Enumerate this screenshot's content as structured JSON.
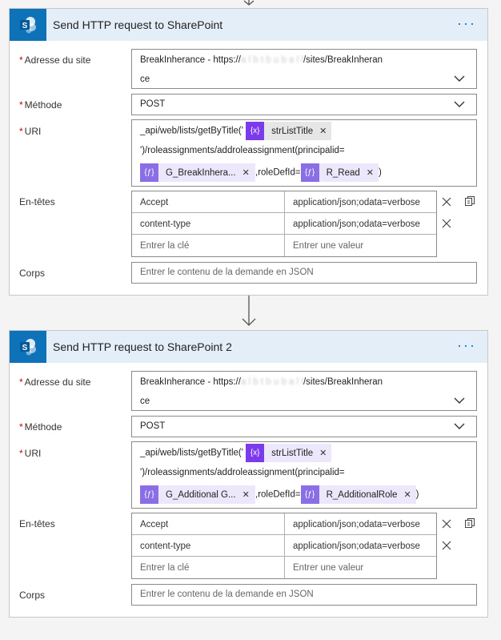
{
  "actions": [
    {
      "title": "Send HTTP request to SharePoint",
      "fields": {
        "site_label": "Adresse du site",
        "site_line1": "BreakInherance - https://",
        "site_blur": "a l  b  t   b  u  b  a  l  l",
        "site_line1_end": "/sites/BreakInheran",
        "site_line2": "ce",
        "method_label": "Méthode",
        "method_value": "POST",
        "uri_label": "URI",
        "uri_line1": "_api/web/lists/getByTitle('",
        "uri_token1": "strListTitle",
        "uri_line2": "')/roleassignments/addroleassignment(principalid=",
        "uri_token2": "G_BreakInhera...",
        "uri_mid": ",roleDefId=",
        "uri_token3": "R_Read",
        "uri_end": ")",
        "headers_label": "En-têtes",
        "headers": [
          {
            "key": "Accept",
            "value": "application/json;odata=verbose"
          },
          {
            "key": "content-type",
            "value": "application/json;odata=verbose"
          }
        ],
        "header_key_placeholder": "Entrer la clé",
        "header_value_placeholder": "Entrer une valeur",
        "body_label": "Corps",
        "body_placeholder": "Entrer le contenu de la demande en JSON"
      }
    },
    {
      "title": "Send HTTP request to SharePoint 2",
      "fields": {
        "site_label": "Adresse du site",
        "site_line1": "BreakInherance - https://",
        "site_blur": "a l  b  t   b  u  b  a  l  l",
        "site_line1_end": "/sites/BreakInheran",
        "site_line2": "ce",
        "method_label": "Méthode",
        "method_value": "POST",
        "uri_label": "URI",
        "uri_line1": "_api/web/lists/getByTitle('",
        "uri_token1": "strListTitle",
        "uri_line2": "')/roleassignments/addroleassignment(principalid=",
        "uri_token2": "G_Additional G...",
        "uri_mid": ",roleDefId=",
        "uri_token3": "R_AdditionalRole",
        "uri_end": ")",
        "headers_label": "En-têtes",
        "headers": [
          {
            "key": "Accept",
            "value": "application/json;odata=verbose"
          },
          {
            "key": "content-type",
            "value": "application/json;odata=verbose"
          }
        ],
        "header_key_placeholder": "Entrer la clé",
        "header_value_placeholder": "Entrer une valeur",
        "body_label": "Corps",
        "body_placeholder": "Entrer le contenu de la demande en JSON"
      }
    }
  ],
  "colors": {
    "header_bg": "#e3eef9",
    "sharepoint_blue": "#0e72b8",
    "variable_purple": "#7c3aed",
    "function_purple": "#8a6ee6",
    "token_gray": "#e6e6e6",
    "token_lilac": "#ede7fb",
    "accent": "#0078d4"
  },
  "icons": {
    "logo": "sharepoint-icon",
    "menu": "more-options-icon",
    "dropdown": "chevron-down-icon",
    "remove": "close-icon",
    "copy": "copy-icon",
    "connector": "arrow-down-icon"
  }
}
